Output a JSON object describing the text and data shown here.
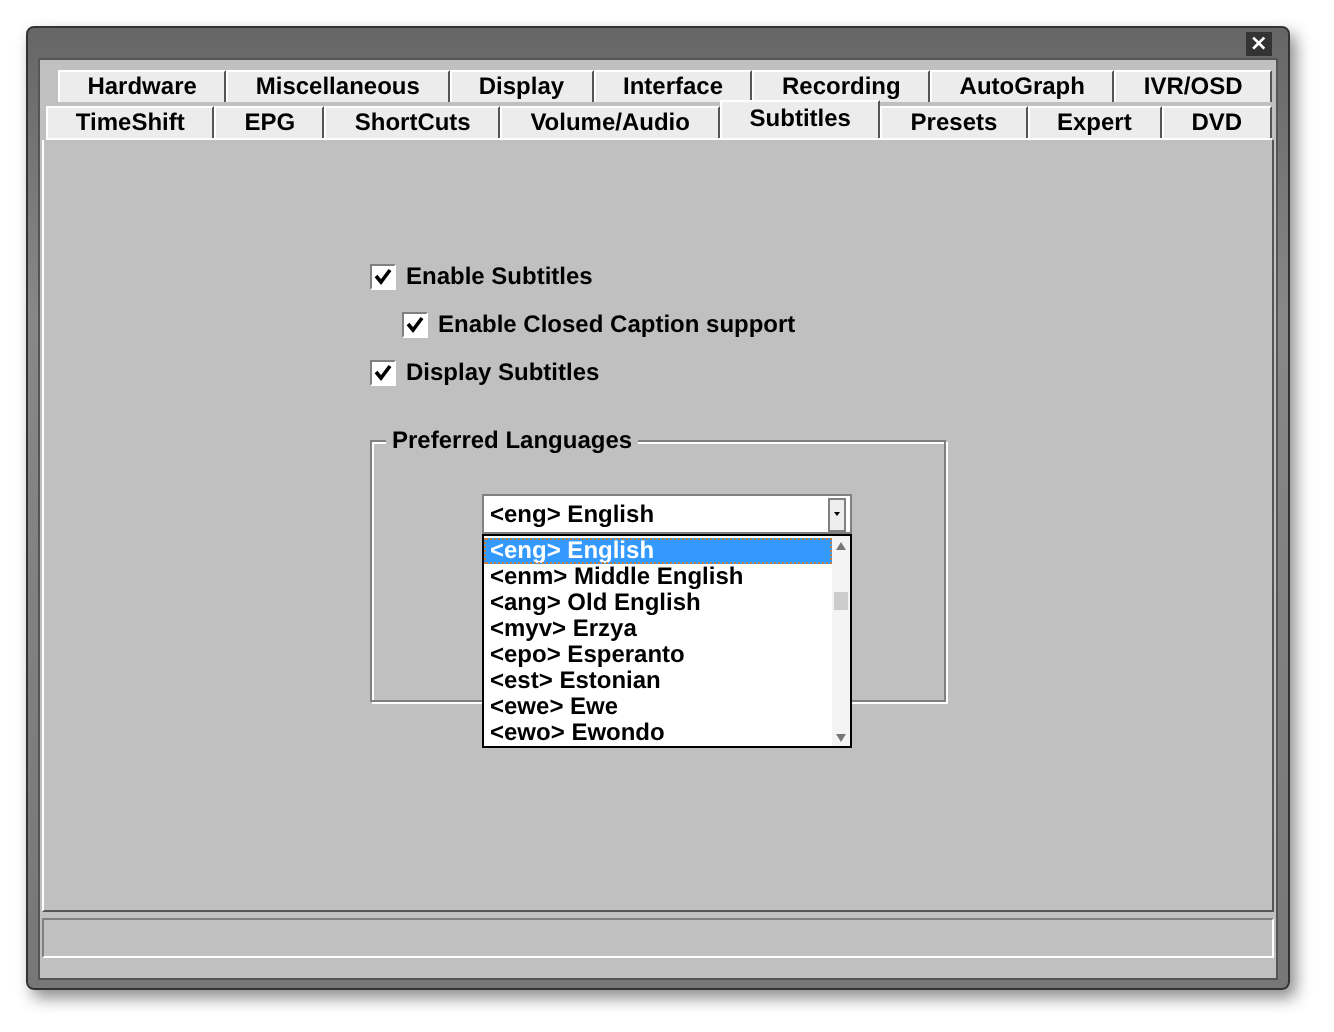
{
  "window": {
    "close": "×"
  },
  "tabs": [
    [
      {
        "label": "Hardware",
        "selected": false
      },
      {
        "label": "Miscellaneous",
        "selected": false
      },
      {
        "label": "Display",
        "selected": false
      },
      {
        "label": "Interface",
        "selected": false
      },
      {
        "label": "Recording",
        "selected": false
      },
      {
        "label": "AutoGraph",
        "selected": false
      },
      {
        "label": "IVR/OSD",
        "selected": false
      }
    ],
    [
      {
        "label": "TimeShift",
        "selected": false
      },
      {
        "label": "EPG",
        "selected": false
      },
      {
        "label": "ShortCuts",
        "selected": false
      },
      {
        "label": "Volume/Audio",
        "selected": false
      },
      {
        "label": "Subtitles",
        "selected": true
      },
      {
        "label": "Presets",
        "selected": false
      },
      {
        "label": "Expert",
        "selected": false
      },
      {
        "label": "DVD",
        "selected": false
      }
    ]
  ],
  "options": [
    {
      "label": "Enable Subtitles",
      "checked": true,
      "children": [
        {
          "label": "Enable Closed Caption support",
          "checked": true
        }
      ]
    },
    {
      "label": "Display Subtitles",
      "checked": true
    }
  ],
  "preferred_languages": {
    "title": "Preferred Languages",
    "value": "<eng> English",
    "list": [
      {
        "label": "<eng> English",
        "selected": true
      },
      {
        "label": "<enm> Middle English",
        "selected": false
      },
      {
        "label": "<ang> Old English",
        "selected": false
      },
      {
        "label": "<myv> Erzya",
        "selected": false
      },
      {
        "label": "<epo> Esperanto",
        "selected": false
      },
      {
        "label": "<est> Estonian",
        "selected": false
      },
      {
        "label": "<ewe> Ewe",
        "selected": false
      },
      {
        "label": "<ewo> Ewondo",
        "selected": false
      }
    ]
  }
}
